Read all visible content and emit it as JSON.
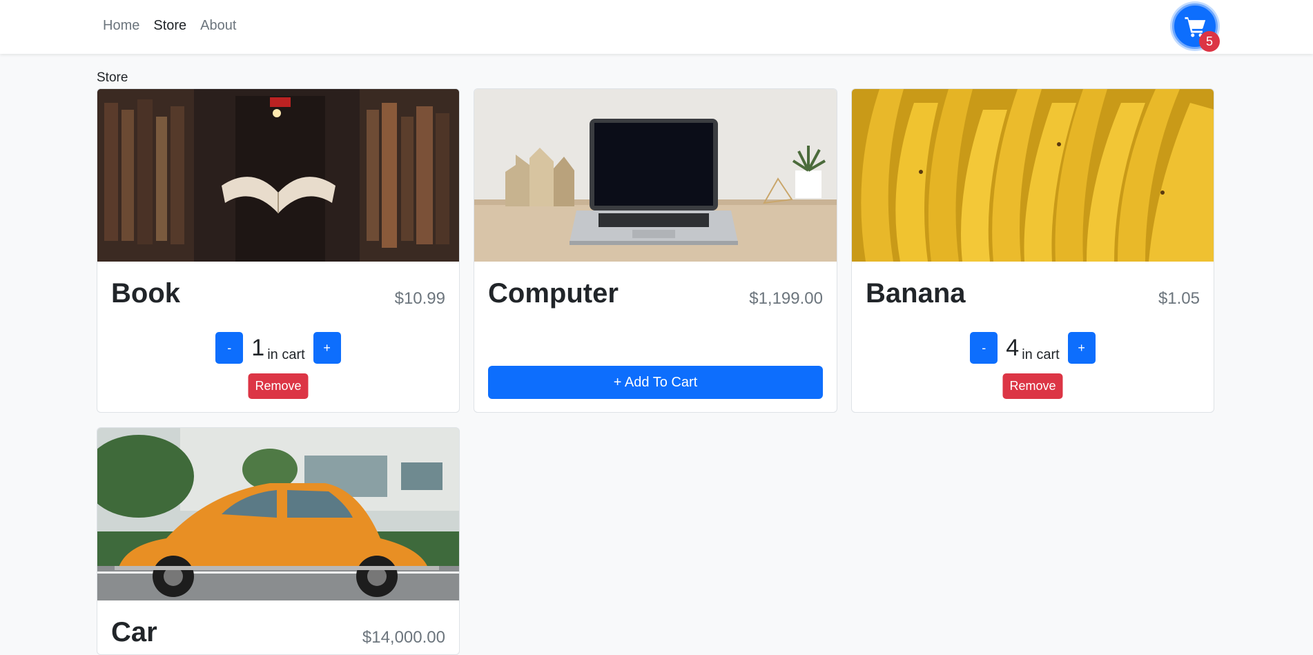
{
  "nav": {
    "links": [
      "Home",
      "Store",
      "About"
    ],
    "active": "Store"
  },
  "cart": {
    "icon": "shopping-cart-icon",
    "count": "5"
  },
  "page": {
    "heading": "Store"
  },
  "products": [
    {
      "name": "Book",
      "price": "$10.99",
      "qty": "1",
      "qty_suffix": "in cart",
      "minus": "-",
      "plus": "+",
      "remove": "Remove"
    },
    {
      "name": "Computer",
      "price": "$1,199.00",
      "add": "+ Add To Cart"
    },
    {
      "name": "Banana",
      "price": "$1.05",
      "qty": "4",
      "qty_suffix": "in cart",
      "minus": "-",
      "plus": "+",
      "remove": "Remove"
    },
    {
      "name": "Car",
      "price": "$14,000.00"
    }
  ],
  "colors": {
    "primary": "#0d6efd",
    "danger": "#dc3545",
    "background": "#f8f9fa"
  }
}
